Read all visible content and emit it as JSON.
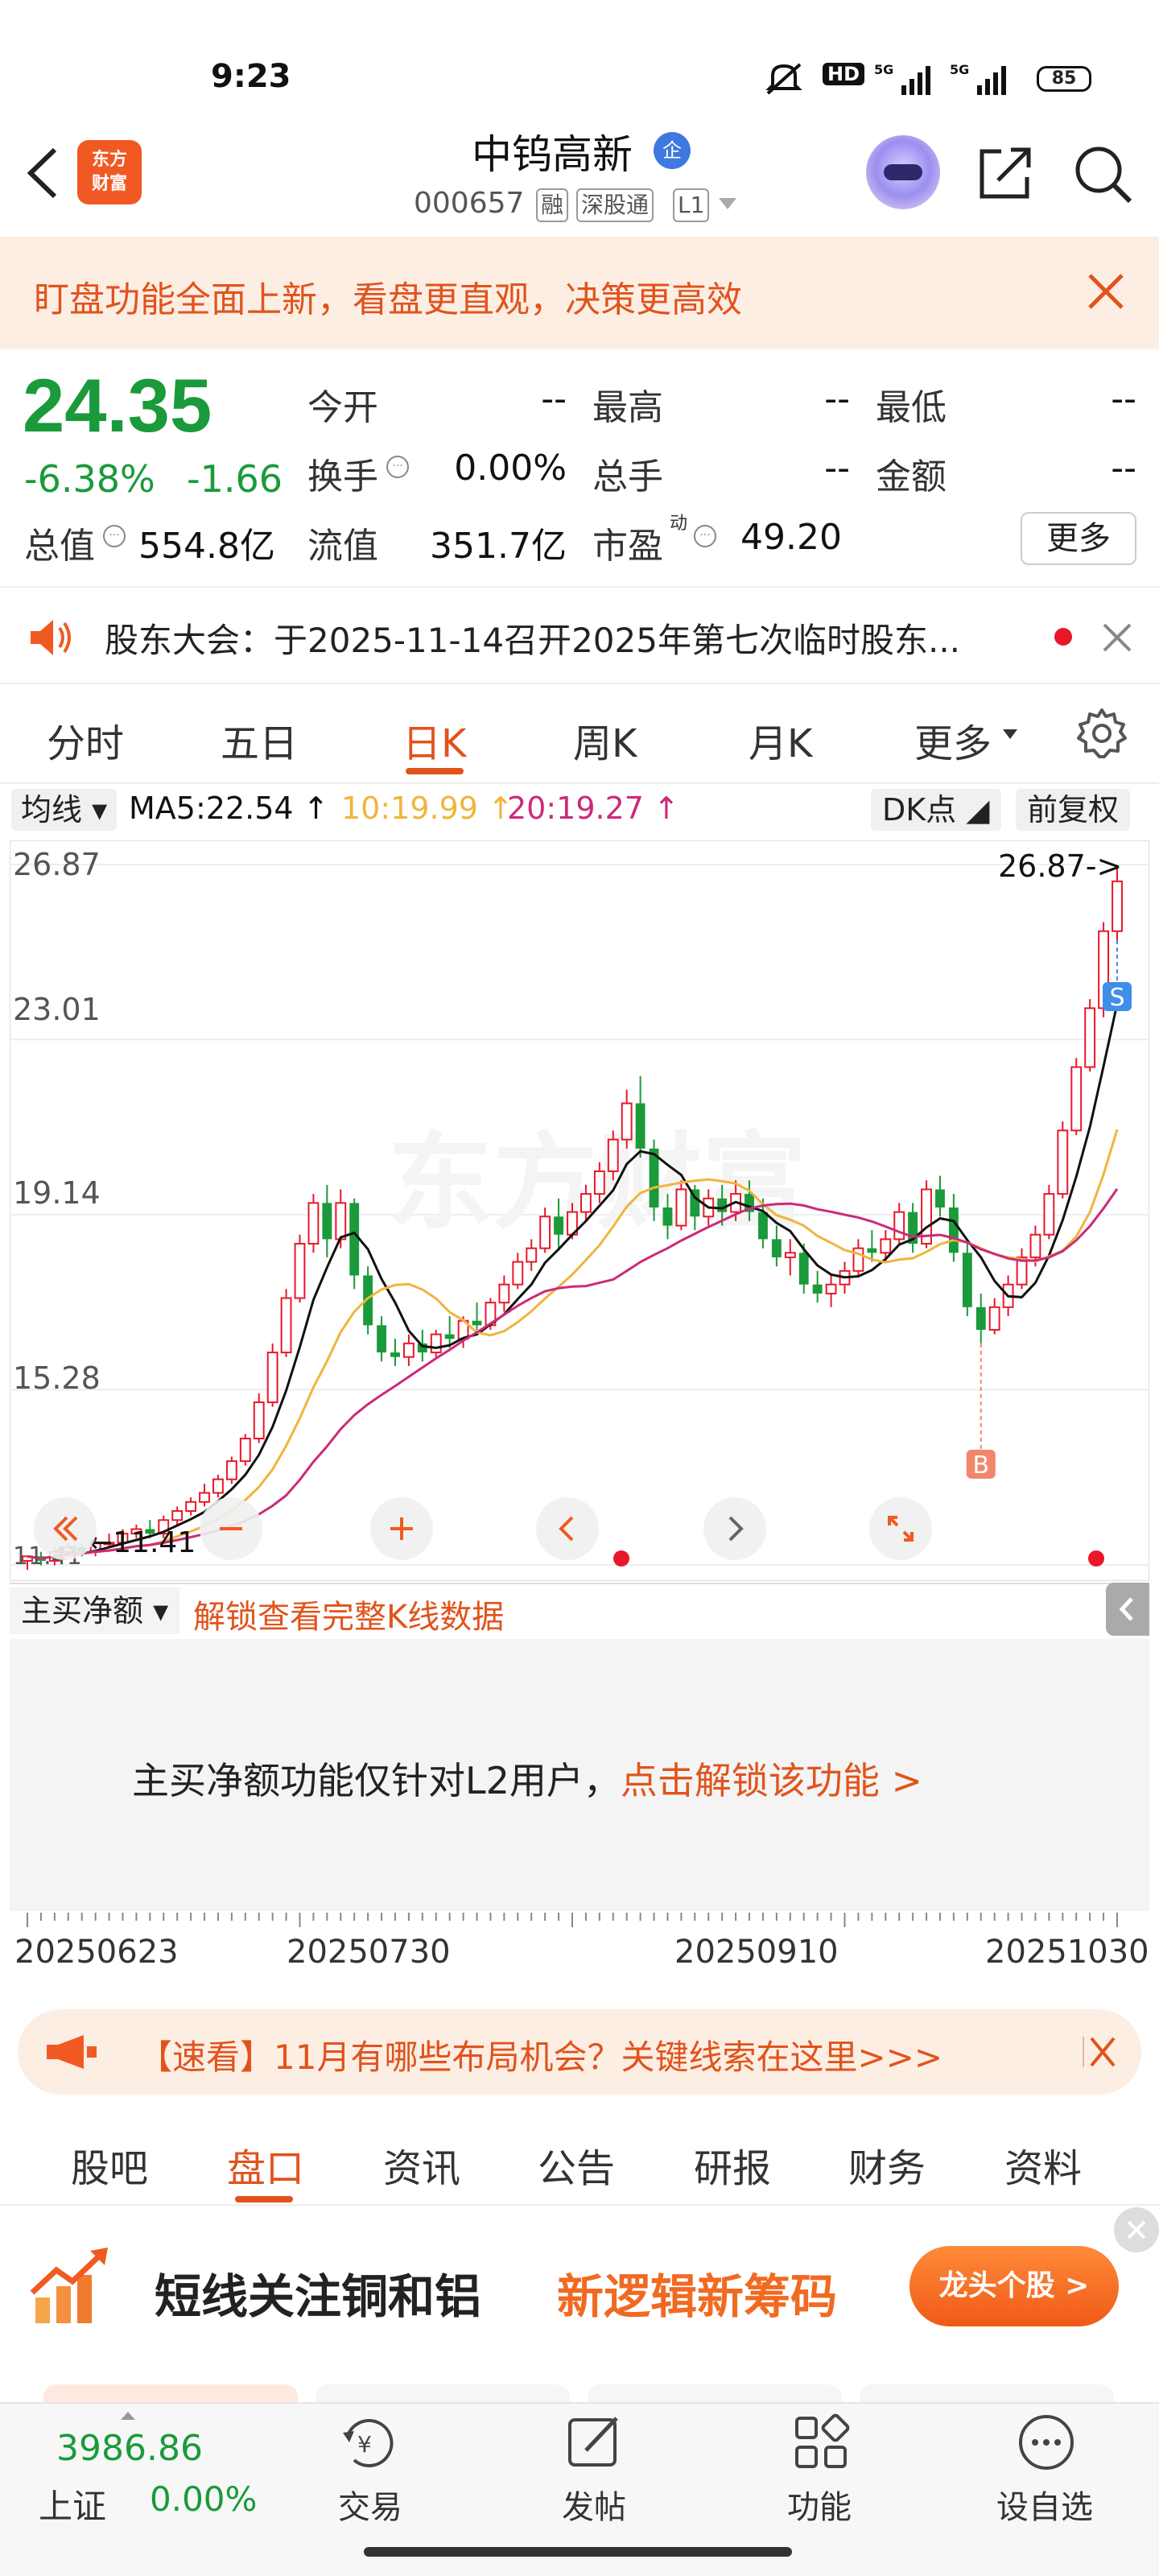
{
  "status_bar": {
    "time": "9:23",
    "signal": "5G",
    "battery": "85"
  },
  "header": {
    "brand_line1": "东方",
    "brand_line2": "财富",
    "stock_name": "中钨高新",
    "ent_badge": "企",
    "stock_code": "000657",
    "tags": [
      "融",
      "深股通",
      "L1"
    ]
  },
  "notice": {
    "text": "盯盘功能全面上新，看盘更直观，决策更高效"
  },
  "quote": {
    "price": "24.35",
    "change_pct": "-6.38%",
    "change_amt": "-1.66",
    "rows": [
      [
        {
          "label": "今开",
          "value": "--"
        },
        {
          "label": "最高",
          "value": "--"
        },
        {
          "label": "最低",
          "value": "--"
        }
      ],
      [
        {
          "label": "换手",
          "value": "0.00%"
        },
        {
          "label": "总手",
          "value": "--"
        },
        {
          "label": "金额",
          "value": "--"
        }
      ]
    ],
    "total_cap_label": "总值",
    "total_cap": "554.8亿",
    "float_cap_label": "流值",
    "float_cap": "351.7亿",
    "pe_label": "市盈",
    "pe_sup": "动",
    "pe": "49.20",
    "more": "更多"
  },
  "announcement": {
    "text": "股东大会：于2025-11-14召开2025年第七次临时股东..."
  },
  "period_tabs": [
    "分时",
    "五日",
    "日K",
    "周K",
    "月K",
    "更多"
  ],
  "active_period": "日K",
  "ma_bar": {
    "type": "均线",
    "ma5": "MA5:22.54 ↑",
    "ma10": "10:19.99 ↑",
    "ma20": "20:19.27 ↑",
    "dk": "DK点",
    "adjust": "前复权"
  },
  "colors": {
    "up": "#e8182a",
    "down": "#1a9a3a",
    "accent": "#e0541c",
    "ma5": "#111111",
    "ma10": "#f0b53c",
    "ma20": "#cc2a7a"
  },
  "chart_data": {
    "type": "candlestick",
    "y_ticks": [
      "26.87",
      "23.01",
      "19.14",
      "15.28",
      "11.41"
    ],
    "ylim": [
      11.41,
      26.87
    ],
    "x_ticks": [
      "20250623",
      "20250730",
      "20250910",
      "20251030"
    ],
    "last_price_pointer": "26.87->",
    "low_label": "11.41",
    "markers": [
      {
        "label": "B",
        "type": "buy"
      },
      {
        "label": "S",
        "type": "sell"
      }
    ],
    "candles": [
      [
        11.5,
        11.6,
        11.3,
        11.6
      ],
      [
        11.6,
        11.7,
        11.4,
        11.5
      ],
      [
        11.5,
        11.8,
        11.4,
        11.7
      ],
      [
        11.7,
        11.9,
        11.6,
        11.8
      ],
      [
        11.8,
        11.9,
        11.6,
        11.7
      ],
      [
        11.7,
        12.0,
        11.6,
        11.9
      ],
      [
        11.9,
        12.1,
        11.8,
        11.9
      ],
      [
        11.9,
        12.2,
        11.8,
        12.1
      ],
      [
        12.1,
        12.3,
        12.0,
        12.2
      ],
      [
        12.2,
        12.4,
        12.0,
        12.1
      ],
      [
        12.1,
        12.5,
        12.0,
        12.4
      ],
      [
        12.4,
        12.7,
        12.3,
        12.6
      ],
      [
        12.6,
        12.9,
        12.5,
        12.8
      ],
      [
        12.8,
        13.2,
        12.7,
        13.0
      ],
      [
        13.0,
        13.4,
        12.9,
        13.3
      ],
      [
        13.3,
        13.8,
        13.2,
        13.7
      ],
      [
        13.7,
        14.3,
        13.6,
        14.2
      ],
      [
        14.2,
        15.2,
        14.1,
        15.0
      ],
      [
        15.0,
        16.3,
        14.9,
        16.1
      ],
      [
        16.1,
        17.5,
        16.0,
        17.3
      ],
      [
        17.3,
        18.7,
        17.2,
        18.5
      ],
      [
        18.5,
        19.6,
        18.3,
        19.4
      ],
      [
        19.4,
        19.8,
        18.2,
        18.6
      ],
      [
        18.6,
        19.7,
        18.4,
        19.4
      ],
      [
        19.4,
        19.5,
        17.5,
        17.8
      ],
      [
        17.8,
        18.0,
        16.5,
        16.7
      ],
      [
        16.7,
        16.9,
        15.9,
        16.1
      ],
      [
        16.1,
        16.4,
        15.8,
        16.0
      ],
      [
        16.0,
        16.5,
        15.8,
        16.3
      ],
      [
        16.3,
        16.6,
        15.9,
        16.1
      ],
      [
        16.1,
        16.6,
        16.0,
        16.5
      ],
      [
        16.5,
        16.9,
        16.2,
        16.4
      ],
      [
        16.4,
        16.9,
        16.2,
        16.8
      ],
      [
        16.8,
        17.2,
        16.6,
        16.7
      ],
      [
        16.7,
        17.3,
        16.6,
        17.2
      ],
      [
        17.2,
        17.8,
        17.0,
        17.6
      ],
      [
        17.6,
        18.3,
        17.5,
        18.1
      ],
      [
        18.1,
        18.6,
        17.9,
        18.4
      ],
      [
        18.4,
        19.3,
        18.3,
        19.1
      ],
      [
        19.1,
        19.5,
        18.4,
        18.7
      ],
      [
        18.7,
        19.4,
        18.6,
        19.2
      ],
      [
        19.2,
        19.8,
        19.0,
        19.6
      ],
      [
        19.6,
        20.3,
        19.4,
        20.1
      ],
      [
        20.1,
        21.0,
        19.9,
        20.8
      ],
      [
        20.8,
        21.9,
        20.6,
        21.6
      ],
      [
        21.6,
        22.2,
        20.4,
        20.6
      ],
      [
        20.6,
        20.8,
        19.0,
        19.3
      ],
      [
        19.3,
        19.6,
        18.6,
        18.9
      ],
      [
        18.9,
        19.9,
        18.8,
        19.7
      ],
      [
        19.7,
        19.8,
        18.8,
        19.1
      ],
      [
        19.1,
        19.7,
        18.9,
        19.5
      ],
      [
        19.5,
        19.8,
        18.9,
        19.2
      ],
      [
        19.2,
        19.9,
        19.0,
        19.6
      ],
      [
        19.6,
        19.9,
        19.0,
        19.2
      ],
      [
        19.2,
        19.5,
        18.4,
        18.6
      ],
      [
        18.6,
        18.9,
        18.0,
        18.2
      ],
      [
        18.2,
        18.6,
        17.8,
        18.3
      ],
      [
        18.3,
        18.5,
        17.4,
        17.6
      ],
      [
        17.6,
        17.9,
        17.2,
        17.4
      ],
      [
        17.4,
        17.8,
        17.1,
        17.6
      ],
      [
        17.6,
        18.1,
        17.4,
        17.9
      ],
      [
        17.9,
        18.6,
        17.8,
        18.4
      ],
      [
        18.4,
        18.8,
        18.1,
        18.3
      ],
      [
        18.3,
        18.8,
        18.1,
        18.6
      ],
      [
        18.6,
        19.4,
        18.5,
        19.2
      ],
      [
        19.2,
        19.4,
        18.3,
        18.5
      ],
      [
        18.5,
        19.9,
        18.4,
        19.7
      ],
      [
        19.7,
        20.0,
        19.1,
        19.3
      ],
      [
        19.3,
        19.6,
        18.1,
        18.3
      ],
      [
        18.3,
        18.5,
        16.9,
        17.1
      ],
      [
        17.1,
        17.4,
        16.3,
        16.6
      ],
      [
        16.6,
        17.3,
        16.5,
        17.1
      ],
      [
        17.1,
        17.8,
        16.9,
        17.6
      ],
      [
        17.6,
        18.4,
        17.5,
        18.2
      ],
      [
        18.2,
        18.9,
        18.0,
        18.7
      ],
      [
        18.7,
        19.8,
        18.6,
        19.6
      ],
      [
        19.6,
        21.2,
        19.5,
        21.0
      ],
      [
        21.0,
        22.6,
        20.9,
        22.4
      ],
      [
        22.4,
        23.9,
        22.3,
        23.7
      ],
      [
        23.7,
        25.6,
        23.5,
        25.4
      ],
      [
        25.4,
        26.8,
        25.2,
        26.5
      ]
    ]
  },
  "indicator": {
    "selector": "主买净额",
    "unlock_hint": "解锁查看完整K线数据",
    "message": "主买净额功能仅针对L2用户，",
    "message_link": "点击解锁该功能 >"
  },
  "promo": {
    "text": "【速看】11月有哪些布局机会？关键线索在这里>>>"
  },
  "section_tabs": [
    "股吧",
    "盘口",
    "资讯",
    "公告",
    "研报",
    "财务",
    "资料"
  ],
  "active_section": "盘口",
  "ad": {
    "title": "短线关注铜和铝",
    "subtitle": "新逻辑新筹码",
    "button": "龙头个股 >"
  },
  "bottom_nav": {
    "index_value": "3986.86",
    "index_name": "上证",
    "index_pct": "0.00%",
    "items": [
      "交易",
      "发帖",
      "功能",
      "设自选"
    ]
  }
}
